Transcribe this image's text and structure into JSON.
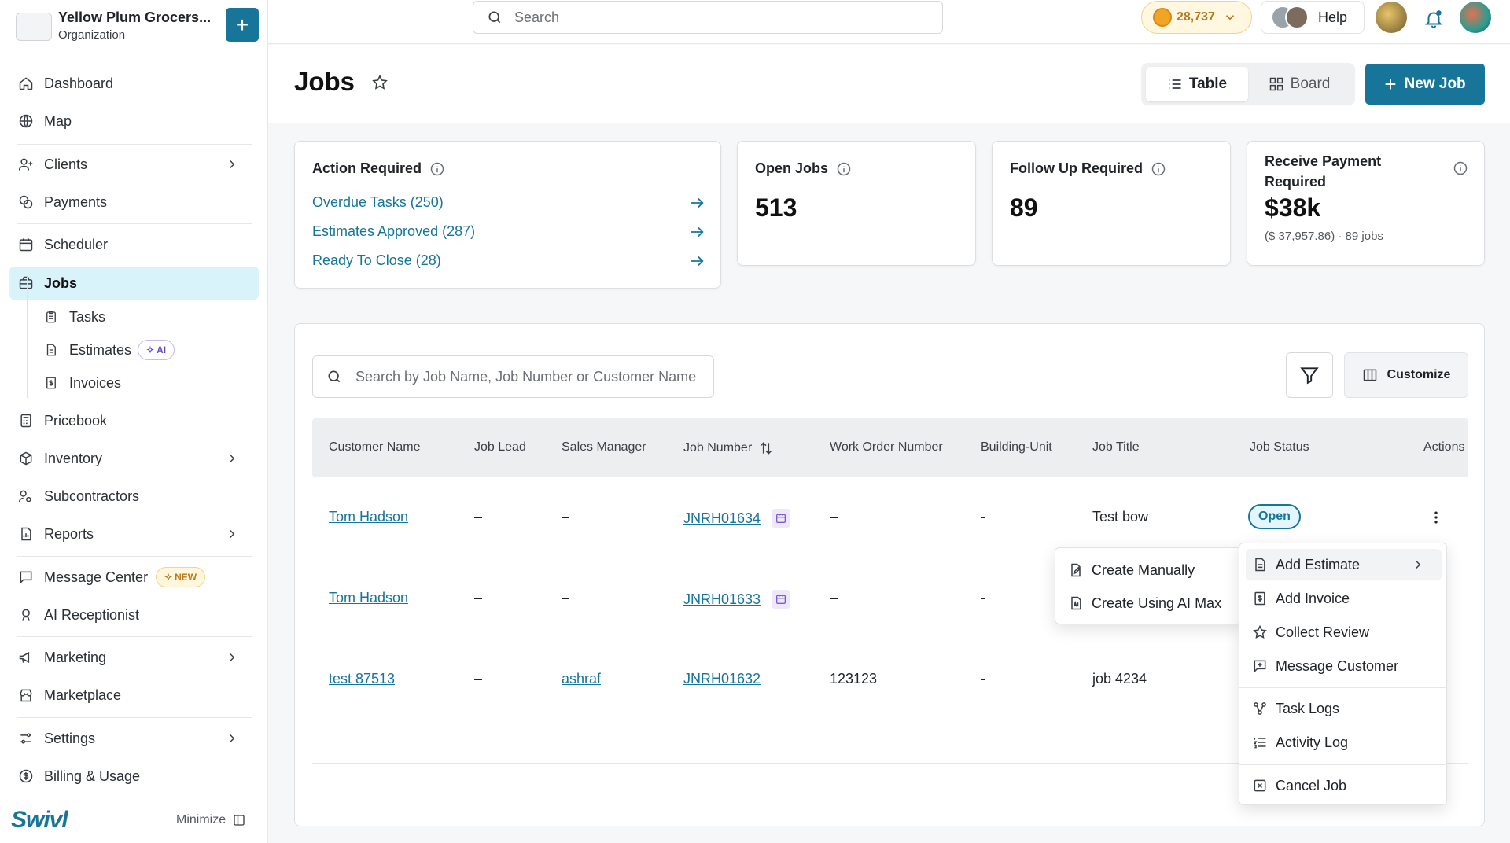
{
  "org": {
    "name": "Yellow Plum Grocers...",
    "sub": "Organization",
    "add_label": "+"
  },
  "nav": {
    "dashboard": "Dashboard",
    "map": "Map",
    "clients": "Clients",
    "payments": "Payments",
    "scheduler": "Scheduler",
    "jobs": "Jobs",
    "tasks": "Tasks",
    "estimates": "Estimates",
    "estimates_badge": "AI",
    "invoices": "Invoices",
    "pricebook": "Pricebook",
    "inventory": "Inventory",
    "subcontractors": "Subcontractors",
    "reports": "Reports",
    "message_center": "Message Center",
    "message_badge": "NEW",
    "ai_receptionist": "AI Receptionist",
    "marketing": "Marketing",
    "marketplace": "Marketplace",
    "settings": "Settings",
    "billing": "Billing & Usage"
  },
  "brand": "Swivl",
  "minimize_label": "Minimize",
  "topbar": {
    "search_placeholder": "Search",
    "coins": "28,737",
    "help": "Help"
  },
  "page": {
    "title": "Jobs",
    "view_table": "Table",
    "view_board": "Board",
    "new_job": "New Job"
  },
  "cards": {
    "action": {
      "title": "Action Required",
      "links": [
        "Overdue Tasks (250)",
        "Estimates Approved (287)",
        "Ready To Close (28)"
      ]
    },
    "open": {
      "title": "Open Jobs",
      "value": "513"
    },
    "follow": {
      "title": "Follow Up Required",
      "value": "89"
    },
    "payment": {
      "title_1": "Receive Payment",
      "title_2": "Required",
      "value": "$38k",
      "sub": "($ 37,957.86) · 89 jobs"
    }
  },
  "table": {
    "search_placeholder": "Search by Job Name, Job Number or Customer Name",
    "customize": "Customize",
    "headers": [
      "Customer Name",
      "Job Lead",
      "Sales Manager",
      "Job Number",
      "Work Order Number",
      "Building-Unit",
      "Job Title",
      "Job Status",
      "Actions"
    ],
    "rows": [
      {
        "customer": "Tom Hadson",
        "lead": "–",
        "sales": "–",
        "number": "JNRH01634",
        "work_order": "–",
        "unit": "-",
        "title": "Test bow",
        "status": "Open"
      },
      {
        "customer": "Tom Hadson",
        "lead": "–",
        "sales": "–",
        "number": "JNRH01633",
        "work_order": "–",
        "unit": "-",
        "title": "",
        "status": ""
      },
      {
        "customer": "test 87513",
        "lead": "–",
        "sales": "ashraf",
        "number": "JNRH01632",
        "work_order": "123123",
        "unit": "-",
        "title": "job 4234",
        "status": ""
      }
    ]
  },
  "actions_menu": {
    "add_estimate": "Add Estimate",
    "add_invoice": "Add Invoice",
    "collect_review": "Collect Review",
    "message_customer": "Message Customer",
    "task_logs": "Task Logs",
    "activity_log": "Activity Log",
    "cancel_job": "Cancel Job"
  },
  "estimate_submenu": {
    "manual": "Create Manually",
    "ai": "Create Using AI Max"
  },
  "colors": {
    "accent": "#17759a",
    "active_nav": "#d9f3fb",
    "coin": "#f0a526"
  }
}
